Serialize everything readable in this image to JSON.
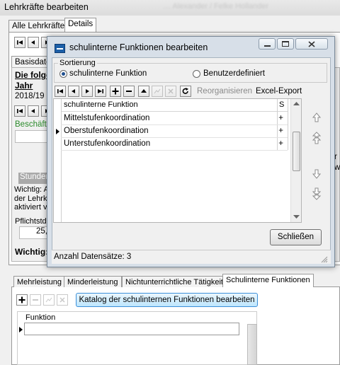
{
  "main": {
    "title": "Lehrkräfte bearbeiten",
    "faded_title": "… Alexander / Felke Hollander",
    "tabs": [
      "Alle Lehrkräfte",
      "Details"
    ],
    "subtab_partial": "Basisdate",
    "heading_partial": "Die folge",
    "heading_line2": "Jahr",
    "year": "2018/19",
    "employment_partial": "Beschäfti",
    "section_partial": "Stunden",
    "warning_lines": [
      "Wichtig: A",
      "der Lehrkr",
      "aktiviert v"
    ],
    "pflicht_label": "Pflichtstd",
    "pflicht_value": "25,",
    "bottom_warning": "Wichtig:",
    "right_chars": [
      "r",
      "w"
    ]
  },
  "dialog": {
    "title": "schulinterne Funktionen bearbeiten",
    "sort_group": "Sortierung",
    "radio_function": "schulinterne Funktion",
    "radio_user": "Benutzerdefiniert",
    "reorganize": "Reorganisieren",
    "excel": "Excel-Export",
    "columns": [
      "schulinterne Funktion",
      "S"
    ],
    "rows": [
      {
        "name": "Mittelstufenkoordination",
        "s": "+",
        "current": false
      },
      {
        "name": "Oberstufenkoordination",
        "s": "+",
        "current": true
      },
      {
        "name": "Unterstufenkoordination",
        "s": "+",
        "current": false
      }
    ],
    "close": "Schließen",
    "status": "Anzahl Datensätze: 3"
  },
  "lower": {
    "tabs": [
      "Mehrleistung",
      "Minderleistung",
      "Nichtunterrichtliche Tätigkeit",
      "Schulinterne Funktionen"
    ],
    "catalog_button": "Katalog der schulinternen Funktionen bearbeiten",
    "column": "Funktion"
  }
}
